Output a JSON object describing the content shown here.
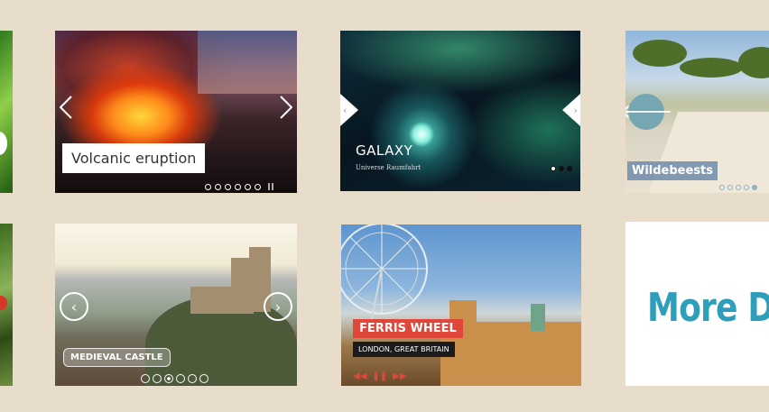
{
  "slides": [
    {
      "title": "Volcanic eruption"
    },
    {
      "title": "GALAXY",
      "subtitle": "Universe Raumfahrt"
    },
    {
      "title": "Wildebeests"
    },
    {
      "title": "MEDIEVAL CASTLE"
    },
    {
      "title": "FERRIS WHEEL",
      "subtitle": "LONDON, GREAT BRITAIN"
    },
    {
      "title": "More De"
    }
  ],
  "pagers": {
    "volcano": {
      "total": 6,
      "active": -1
    },
    "galaxy": {
      "total": 3,
      "active": 0
    },
    "wildebeest": {
      "total": 5,
      "active": 4
    },
    "castle": {
      "total": 6,
      "active": 2
    }
  },
  "icons": {
    "prev": "‹",
    "next": "›",
    "arrow_left": "🡐",
    "rewind": "◀◀",
    "pause": "❚❚",
    "forward": "▶▶"
  },
  "colors": {
    "background": "#e8dccb",
    "accent_red": "#e0473a",
    "accent_teal": "#2e9fba"
  }
}
